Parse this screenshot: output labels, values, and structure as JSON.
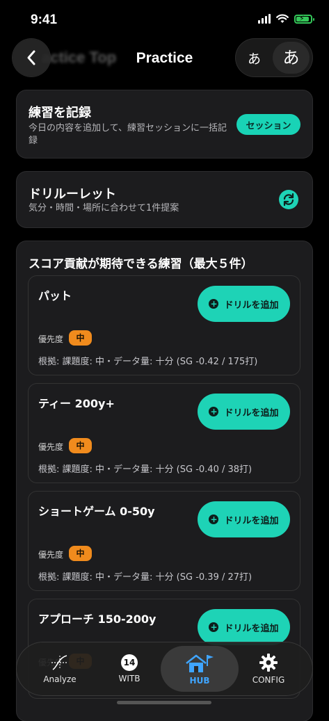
{
  "status_bar": {
    "time": "9:41"
  },
  "nav": {
    "back_ghost_title": "actice Top",
    "title": "Practice",
    "lang_option_1": "あ",
    "lang_option_2": "あ"
  },
  "record_card": {
    "title": "練習を記録",
    "subtitle": "今日の内容を追加して、練習セッションに一括記録",
    "button_label": "セッション"
  },
  "roulette_card": {
    "title": "ドリルーレット",
    "subtitle": "気分・時間・場所に合わせて1件提案"
  },
  "drills_section": {
    "title": "スコア貢献が期待できる練習（最大５件）",
    "priority_label": "優先度",
    "add_button_label": "ドリルを追加",
    "items": [
      {
        "name": "パット",
        "priority": "中",
        "basis": "根拠: 課題度: 中・データ量: 十分 (SG -0.42 / 175打)"
      },
      {
        "name": "ティー 200y+",
        "priority": "中",
        "basis": "根拠: 課題度: 中・データ量: 十分 (SG -0.40 / 38打)"
      },
      {
        "name": "ショートゲーム 0-50y",
        "priority": "中",
        "basis": "根拠: 課題度: 中・データ量: 十分 (SG -0.39 / 27打)"
      },
      {
        "name": "アプローチ 150-200y",
        "priority": "中",
        "basis": ""
      }
    ]
  },
  "tab_bar": {
    "tabs": [
      {
        "label": "Analyze",
        "icon": "analyze-icon"
      },
      {
        "label": "WITB",
        "icon": "witb-badge-icon",
        "badge": "14"
      },
      {
        "label": "HUB",
        "icon": "hub-house-flag-icon"
      },
      {
        "label": "CONFIG",
        "icon": "gear-icon"
      }
    ]
  },
  "colors": {
    "accent_teal": "#1ed3b6",
    "priority_orange": "#f08b1d",
    "hub_blue": "#3fa5ff"
  }
}
